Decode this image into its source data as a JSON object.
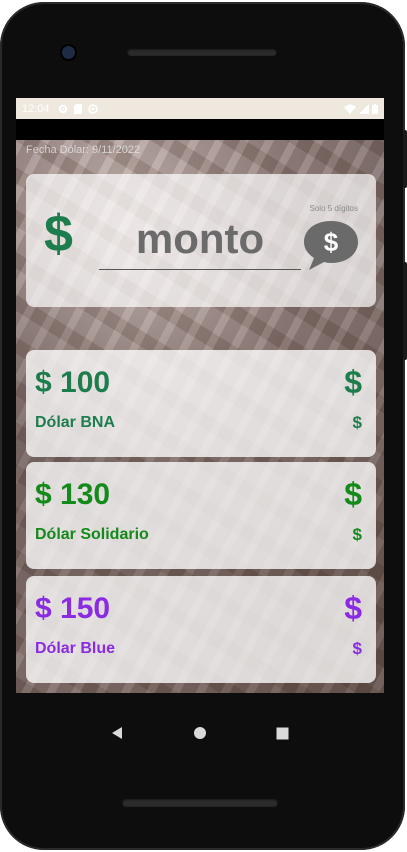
{
  "status_bar": {
    "time": "12:04"
  },
  "header": {
    "fecha": "Fecha Dólar: 9/11/2022"
  },
  "monto": {
    "placeholder": "monto",
    "hint": "Solo 5 dígitos",
    "dollar_symbol": "$"
  },
  "rates": [
    {
      "value": "$ 100",
      "name": "Dólar BNA",
      "symbol": "$",
      "color": "#1e7d4d"
    },
    {
      "value": "$ 130",
      "name": "Dólar Solidario",
      "symbol": "$",
      "color": "#138a1a"
    },
    {
      "value": "$ 150",
      "name": "Dólar Blue",
      "symbol": "$",
      "color": "#8a2be2"
    }
  ],
  "icons": {
    "status": [
      "settings-icon",
      "sim-icon",
      "data-saver-icon",
      "wifi-icon",
      "signal-icon",
      "battery-icon"
    ],
    "chat": "chat-dollar-icon",
    "nav": [
      "back-icon",
      "home-icon",
      "recents-icon"
    ]
  }
}
